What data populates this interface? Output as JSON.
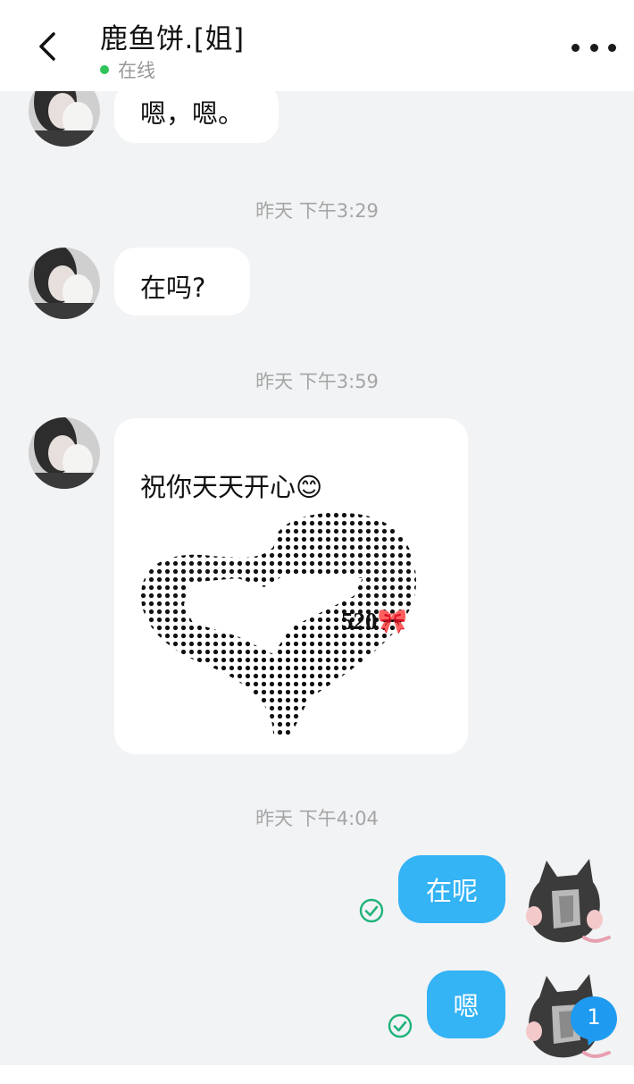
{
  "header": {
    "back_icon": "chevron-left-icon",
    "contact_name": "鹿鱼饼.[姐]",
    "status": "在线",
    "status_color": "#2ec45a",
    "more_icon": "more-dots-icon"
  },
  "messages": [
    {
      "side": "left",
      "text": "嗯，嗯。"
    },
    {
      "type": "time",
      "text": "昨天 下午3:29"
    },
    {
      "side": "left",
      "text": "在吗?"
    },
    {
      "type": "time",
      "text": "昨天 下午3:59"
    },
    {
      "side": "left",
      "text": "祝你天天开心😊",
      "image_text": "520🎀"
    },
    {
      "type": "time",
      "text": "昨天 下午4:04"
    },
    {
      "side": "right",
      "text": "在呢",
      "status_icon": "read-check-icon"
    },
    {
      "side": "right",
      "text": "嗯",
      "status_icon": "read-check-icon"
    }
  ],
  "unread_badge": "1",
  "colors": {
    "accent_bubble": "#34b3f5",
    "read_check": "#1fb37a",
    "badge": "#1e9bf0",
    "background": "#f2f3f5"
  }
}
